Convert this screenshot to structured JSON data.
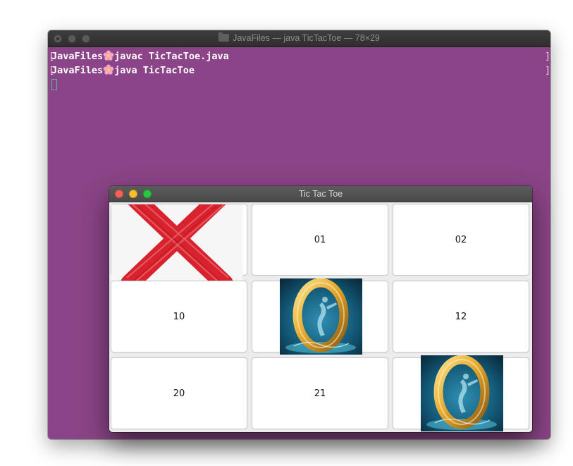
{
  "terminal": {
    "title": "JavaFiles — java TicTacToe — 78×29",
    "background": "#8b4487",
    "lines": [
      {
        "prompt": "JavaFiles",
        "command": "javac TicTacToe.java"
      },
      {
        "prompt": "JavaFiles",
        "command": "java TicTacToe"
      }
    ]
  },
  "game_window": {
    "title": "Tic Tac Toe",
    "cells": [
      {
        "label": "",
        "mark": "X"
      },
      {
        "label": "01",
        "mark": ""
      },
      {
        "label": "02",
        "mark": ""
      },
      {
        "label": "10",
        "mark": ""
      },
      {
        "label": "",
        "mark": "O"
      },
      {
        "label": "12",
        "mark": ""
      },
      {
        "label": "20",
        "mark": ""
      },
      {
        "label": "21",
        "mark": ""
      },
      {
        "label": "",
        "mark": "O"
      }
    ]
  },
  "icons": {
    "prompt_separator": "cherry-blossom-icon",
    "terminal_folder": "folder-icon"
  }
}
